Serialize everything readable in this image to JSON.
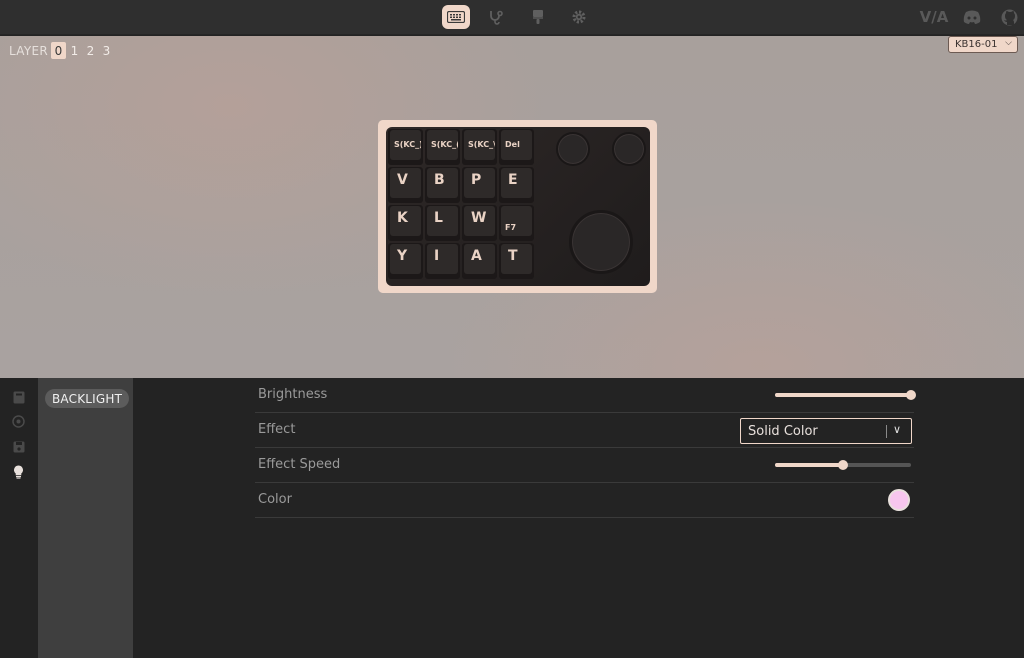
{
  "nav": {
    "icons": [
      "keyboard-icon",
      "stethoscope-icon",
      "brush-icon",
      "gear-icon"
    ],
    "active": "keyboard-icon",
    "right": [
      "via-logo",
      "discord-icon",
      "github-icon"
    ],
    "via_text": "V/A"
  },
  "layers": {
    "label": "LAYER",
    "items": [
      "0",
      "1",
      "2",
      "3"
    ],
    "active": "0"
  },
  "device": {
    "selected": "KB16-01"
  },
  "keyboard": {
    "rows": [
      [
        "S(KC_)",
        "S(KC_(",
        "S(KC_\\",
        "Del"
      ],
      [
        "V",
        "B",
        "P",
        "E"
      ],
      [
        "K",
        "L",
        "W",
        "F7"
      ],
      [
        "Y",
        "I",
        "A",
        "T"
      ]
    ]
  },
  "sidebar": {
    "icons": [
      "book-icon",
      "circle-icon",
      "save-icon",
      "lightbulb-icon"
    ],
    "active": "lightbulb-icon"
  },
  "menu": {
    "items": [
      "BACKLIGHT"
    ]
  },
  "settings": {
    "brightness": {
      "label": "Brightness",
      "value": 1.0
    },
    "effect": {
      "label": "Effect",
      "value": "Solid Color"
    },
    "speed": {
      "label": "Effect Speed",
      "value": 0.5
    },
    "color": {
      "label": "Color",
      "value": "#f7c6ee"
    }
  },
  "colors": {
    "accent": "#f0d7c9"
  }
}
